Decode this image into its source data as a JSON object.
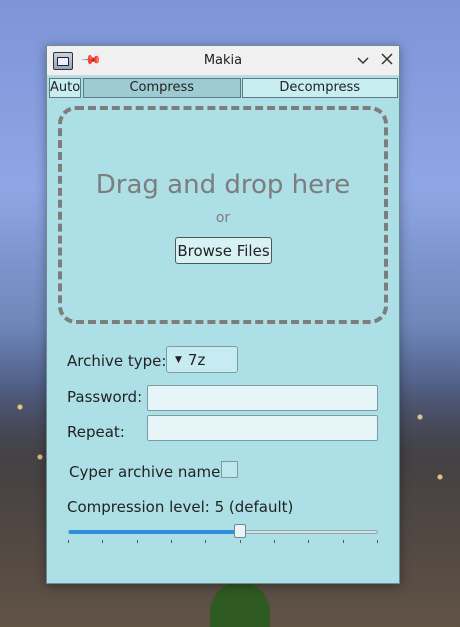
{
  "window": {
    "title": "Makia",
    "icons": {
      "app": "archive-manager-icon",
      "pin": "pin-icon",
      "minimize": "chevron-down-icon",
      "close": "close-icon"
    }
  },
  "tabs": [
    {
      "label": "Auto",
      "active": false
    },
    {
      "label": "Compress",
      "active": true
    },
    {
      "label": "Decompress",
      "active": false
    }
  ],
  "dropzone": {
    "title": "Drag and drop here",
    "or_text": "or",
    "browse_label": "Browse Files"
  },
  "form": {
    "archive_type_label": "Archive type:",
    "archive_type_value": "7z",
    "password_label": "Password:",
    "password_value": "",
    "repeat_label": "Repeat:",
    "repeat_value": "",
    "cypher_label": "Cyper archive names",
    "cypher_checked": false,
    "compression_label": "Compression level: 5 (default)",
    "compression_level": 5,
    "compression_min": 0,
    "compression_max": 9
  },
  "colors": {
    "window_bg": "#ade0e6",
    "active_tab": "#9ecbd2",
    "slider_fill": "#2f8fd8",
    "dropzone_border": "#7d7d7d"
  }
}
